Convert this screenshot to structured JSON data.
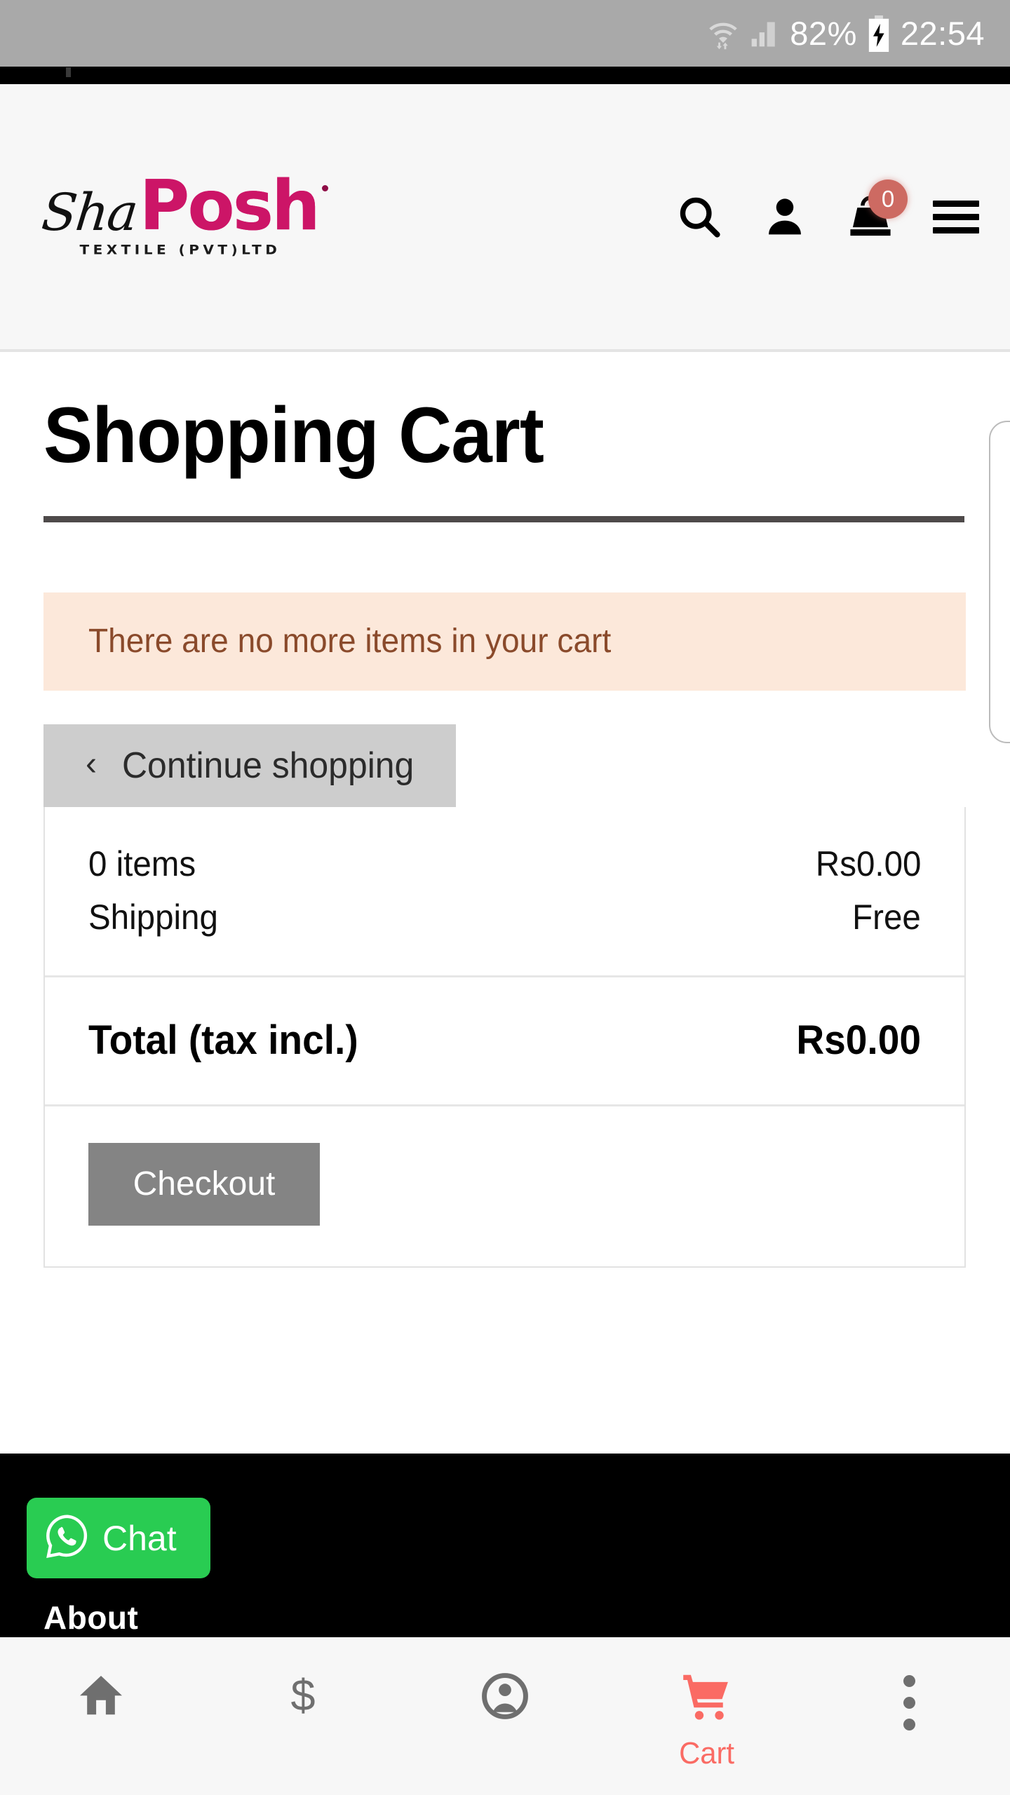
{
  "status_bar": {
    "battery_percent": "82%",
    "time": "22:54",
    "wifi_icon": "wifi-icon",
    "signal_icon": "signal-icon",
    "battery_icon": "battery-charging-icon"
  },
  "header": {
    "logo": {
      "script_text": "Sha",
      "bold_text": "Posh",
      "subtitle": "TEXTILE (PVT)LTD",
      "brand_color": "#cc1567"
    },
    "icons": {
      "search": "search-icon",
      "account": "user-icon",
      "cart": "shopping-bag-icon",
      "menu": "hamburger-menu-icon"
    },
    "cart_badge_count": "0",
    "cart_badge_color": "#cd6a62"
  },
  "page": {
    "title": "Shopping Cart"
  },
  "alert": {
    "message": "There are no more items in your cart",
    "background": "#fce8da",
    "text_color": "#8a4a2b"
  },
  "continue_shopping": {
    "label": "Continue shopping",
    "chevron": "‹"
  },
  "summary": {
    "rows": [
      {
        "label": "0 items",
        "value": "Rs0.00"
      },
      {
        "label": "Shipping",
        "value": "Free"
      }
    ],
    "total_label": "Total (tax incl.)",
    "total_value": "Rs0.00",
    "checkout_label": "Checkout"
  },
  "footer": {
    "chat_label": "Chat",
    "chat_icon": "whatsapp-icon",
    "chat_color": "#29cc52",
    "heading": "About"
  },
  "bottom_nav": {
    "active_color": "#fa6b64",
    "items": [
      {
        "name": "home",
        "icon": "home-icon",
        "label": ""
      },
      {
        "name": "price",
        "icon": "dollar-icon",
        "label": ""
      },
      {
        "name": "account",
        "icon": "account-circle-icon",
        "label": ""
      },
      {
        "name": "cart",
        "icon": "shopping-cart-icon",
        "label": "Cart"
      },
      {
        "name": "more",
        "icon": "more-vertical-icon",
        "label": ""
      }
    ]
  }
}
